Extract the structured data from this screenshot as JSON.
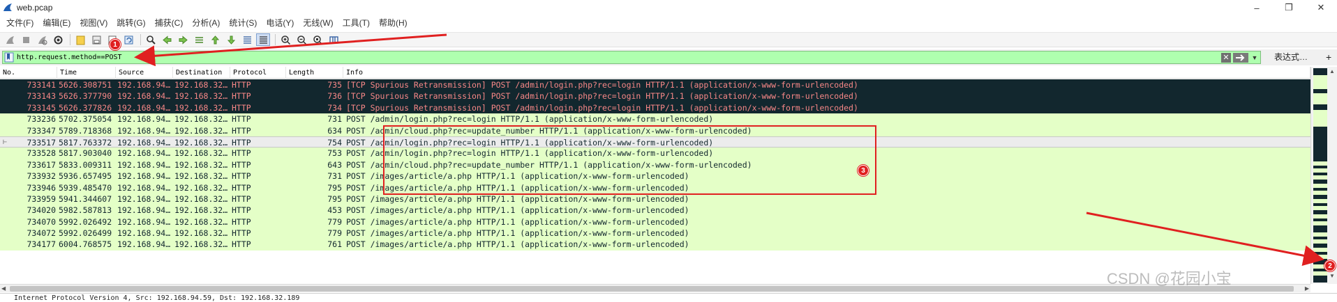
{
  "window": {
    "title": "web.pcap",
    "controls": [
      "–",
      "❐",
      "✕"
    ]
  },
  "menu": [
    "文件(F)",
    "编辑(E)",
    "视图(V)",
    "跳转(G)",
    "捕获(C)",
    "分析(A)",
    "统计(S)",
    "电话(Y)",
    "无线(W)",
    "工具(T)",
    "帮助(H)"
  ],
  "toolbar": {
    "buttons": [
      "shark-fin-start-icon",
      "stop-icon",
      "restart-icon",
      "options-icon",
      "open-file-icon",
      "save-icon",
      "close-file-icon",
      "reload-icon",
      "find-icon",
      "back-icon",
      "forward-icon",
      "go-to-icon",
      "first-icon",
      "last-icon",
      "autoscroll-icon",
      "colorize-icon",
      "zoom-in-icon",
      "zoom-out-icon",
      "zoom-normal-icon",
      "resize-columns-icon"
    ]
  },
  "filter": {
    "value": "http.request.method==POST",
    "clear": "✕",
    "expression_label": "表达式…",
    "add": "+"
  },
  "columns": [
    "No.",
    "Time",
    "Source",
    "Destination",
    "Protocol",
    "Length",
    "Info"
  ],
  "packets": [
    {
      "no": "733141",
      "time": "5626.308751",
      "src": "192.168.94…",
      "dst": "192.168.32…",
      "proto": "HTTP",
      "len": "735",
      "info": "[TCP Spurious Retransmission] POST /admin/login.php?rec=login HTTP/1.1  (application/x-www-form-urlencoded)",
      "style": "dark"
    },
    {
      "no": "733143",
      "time": "5626.377790",
      "src": "192.168.94…",
      "dst": "192.168.32…",
      "proto": "HTTP",
      "len": "736",
      "info": "[TCP Spurious Retransmission] POST /admin/login.php?rec=login HTTP/1.1  (application/x-www-form-urlencoded)",
      "style": "dark"
    },
    {
      "no": "733145",
      "time": "5626.377826",
      "src": "192.168.94…",
      "dst": "192.168.32…",
      "proto": "HTTP",
      "len": "734",
      "info": "[TCP Spurious Retransmission] POST /admin/login.php?rec=login HTTP/1.1  (application/x-www-form-urlencoded)",
      "style": "dark"
    },
    {
      "no": "733236",
      "time": "5702.375054",
      "src": "192.168.94…",
      "dst": "192.168.32…",
      "proto": "HTTP",
      "len": "731",
      "info": "POST /admin/login.php?rec=login HTTP/1.1  (application/x-www-form-urlencoded)",
      "style": "light"
    },
    {
      "no": "733347",
      "time": "5789.718368",
      "src": "192.168.94…",
      "dst": "192.168.32…",
      "proto": "HTTP",
      "len": "634",
      "info": "POST /admin/cloud.php?rec=update_number HTTP/1.1  (application/x-www-form-urlencoded)",
      "style": "light"
    },
    {
      "no": "733517",
      "time": "5817.763372",
      "src": "192.168.94…",
      "dst": "192.168.32…",
      "proto": "HTTP",
      "len": "754",
      "info": "POST /admin/login.php?rec=login HTTP/1.1  (application/x-www-form-urlencoded)",
      "style": "selected"
    },
    {
      "no": "733528",
      "time": "5817.903040",
      "src": "192.168.94…",
      "dst": "192.168.32…",
      "proto": "HTTP",
      "len": "753",
      "info": "POST /admin/login.php?rec=login HTTP/1.1  (application/x-www-form-urlencoded)",
      "style": "light"
    },
    {
      "no": "733617",
      "time": "5833.009311",
      "src": "192.168.94…",
      "dst": "192.168.32…",
      "proto": "HTTP",
      "len": "643",
      "info": "POST /admin/cloud.php?rec=update_number HTTP/1.1  (application/x-www-form-urlencoded)",
      "style": "light"
    },
    {
      "no": "733932",
      "time": "5936.657495",
      "src": "192.168.94…",
      "dst": "192.168.32…",
      "proto": "HTTP",
      "len": "731",
      "info": "POST /images/article/a.php HTTP/1.1  (application/x-www-form-urlencoded)",
      "style": "light"
    },
    {
      "no": "733946",
      "time": "5939.485470",
      "src": "192.168.94…",
      "dst": "192.168.32…",
      "proto": "HTTP",
      "len": "795",
      "info": "POST /images/article/a.php HTTP/1.1  (application/x-www-form-urlencoded)",
      "style": "light"
    },
    {
      "no": "733959",
      "time": "5941.344607",
      "src": "192.168.94…",
      "dst": "192.168.32…",
      "proto": "HTTP",
      "len": "795",
      "info": "POST /images/article/a.php HTTP/1.1  (application/x-www-form-urlencoded)",
      "style": "light"
    },
    {
      "no": "734020",
      "time": "5982.587813",
      "src": "192.168.94…",
      "dst": "192.168.32…",
      "proto": "HTTP",
      "len": "453",
      "info": "POST /images/article/a.php HTTP/1.1  (application/x-www-form-urlencoded)",
      "style": "light"
    },
    {
      "no": "734070",
      "time": "5992.026492",
      "src": "192.168.94…",
      "dst": "192.168.32…",
      "proto": "HTTP",
      "len": "779",
      "info": "POST /images/article/a.php HTTP/1.1  (application/x-www-form-urlencoded)",
      "style": "light"
    },
    {
      "no": "734072",
      "time": "5992.026499",
      "src": "192.168.94…",
      "dst": "192.168.32…",
      "proto": "HTTP",
      "len": "779",
      "info": "POST /images/article/a.php HTTP/1.1  (application/x-www-form-urlencoded)",
      "style": "light"
    },
    {
      "no": "734177",
      "time": "6004.768575",
      "src": "192.168.94…",
      "dst": "192.168.32…",
      "proto": "HTTP",
      "len": "761",
      "info": "POST /images/article/a.php HTTP/1.1  (application/x-www-form-urlencoded)",
      "style": "light"
    }
  ],
  "detail": {
    "text": "Internet Protocol Version 4, Src: 192.168.94.59, Dst: 192.168.32.189"
  },
  "annotations": {
    "badges": [
      "1",
      "2",
      "3"
    ],
    "annotation_color": "#e02020",
    "watermark": "CSDN @花园小宝"
  },
  "colors": {
    "filter_valid": "#afffaf",
    "row_dark_bg": "#12272e",
    "row_dark_fg": "#f78787",
    "row_light_bg": "#e4ffc7",
    "row_light_fg": "#12272e",
    "row_selected_bg": "#ececec"
  }
}
